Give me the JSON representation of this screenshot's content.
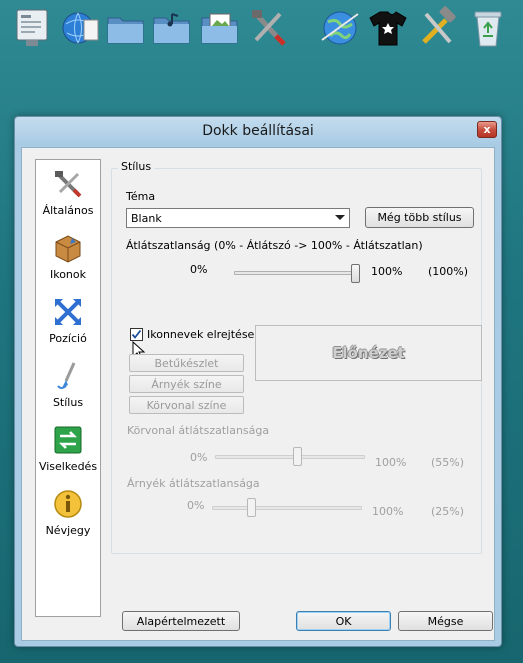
{
  "dock": {
    "icons": [
      "settings-panel-icon",
      "globe-network-icon",
      "folder-icon",
      "music-folder-icon",
      "pictures-folder-icon",
      "tools-icon",
      "browser-icon",
      "tshirt-icon",
      "hammer-wrench-icon",
      "recycle-bin-icon"
    ]
  },
  "window": {
    "title": "Dokk beállításai",
    "close_label": "x"
  },
  "sidebar": {
    "items": [
      {
        "label": "Általános",
        "icon": "tools-icon"
      },
      {
        "label": "Ikonok",
        "icon": "package-icon"
      },
      {
        "label": "Pozíció",
        "icon": "arrows-icon"
      },
      {
        "label": "Stílus",
        "icon": "paintbrush-icon"
      },
      {
        "label": "Viselkedés",
        "icon": "switch-arrows-icon"
      },
      {
        "label": "Névjegy",
        "icon": "info-icon"
      }
    ],
    "selected": "Stílus"
  },
  "style": {
    "group_title": "Stílus",
    "theme_label": "Téma",
    "theme_value": "Blank",
    "more_styles_label": "Még több stílus",
    "opacity_label": "Átlátszatlanság (0% - Átlátszó -> 100% - Átlátszatlan)",
    "opacity_min": "0%",
    "opacity_max": "100%",
    "opacity_value_text": "(100%)",
    "opacity_value": 100,
    "hide_icons_label": "Ikonnevek elrejtése",
    "hide_icons_checked": true,
    "font_button": "Betűkészlet",
    "shadow_color_button": "Árnyék színe",
    "outline_color_button": "Körvonal színe",
    "preview_text": "Előnézet",
    "outline_opacity_label": "Körvonal átlátszatlansága",
    "outline_min": "0%",
    "outline_max": "100%",
    "outline_value_text": "(55%)",
    "outline_value": 55,
    "shadow_opacity_label": "Árnyék átlátszatlansága",
    "shadow_min": "0%",
    "shadow_max": "100%",
    "shadow_value_text": "(25%)",
    "shadow_value": 25
  },
  "footer": {
    "defaults_label": "Alapértelmezett",
    "ok_label": "OK",
    "cancel_label": "Mégse"
  },
  "colors": {
    "desktop": "#1f7680",
    "window_frame": "#a9cbe3",
    "close_red": "#c7503f",
    "disabled_text": "#a0a0a0"
  }
}
